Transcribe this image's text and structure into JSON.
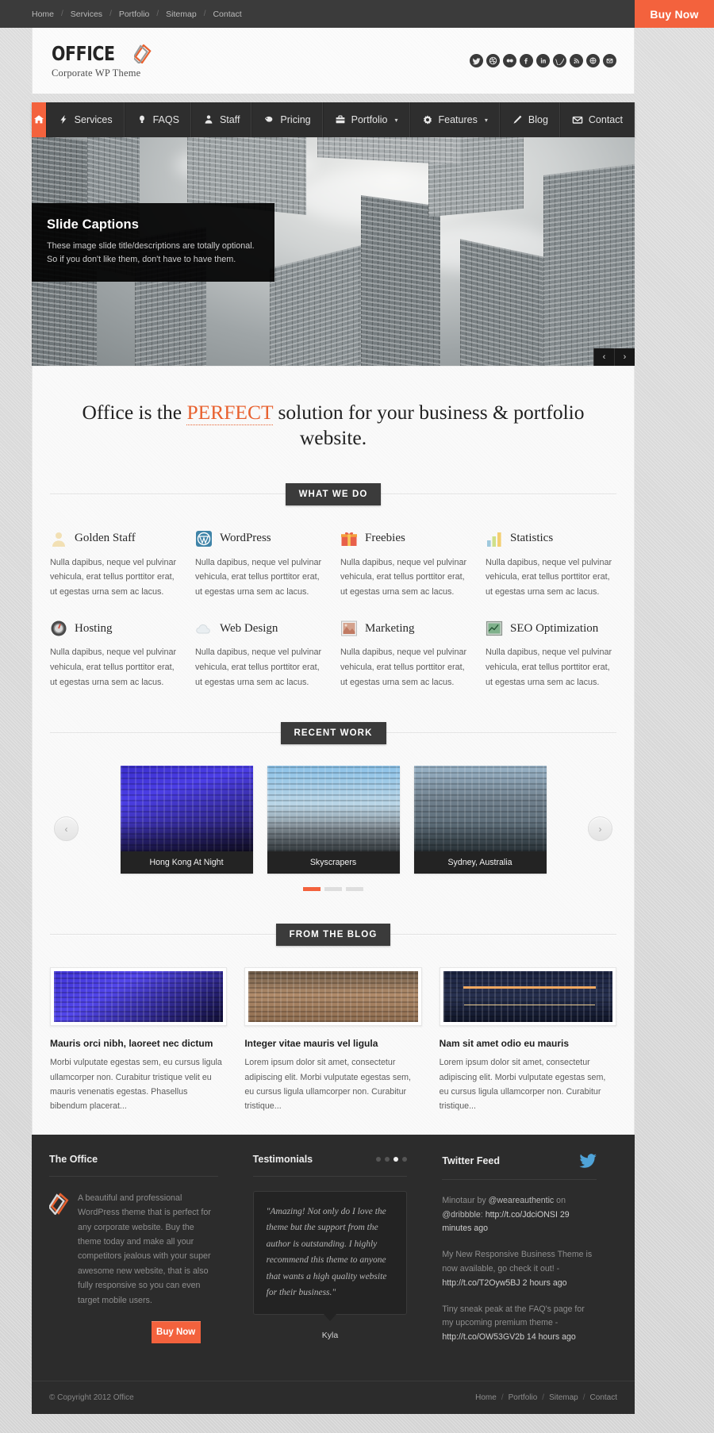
{
  "topbar": {
    "links": [
      "Home",
      "Services",
      "Portfolio",
      "Sitemap",
      "Contact"
    ],
    "buy_now": "Buy Now"
  },
  "header": {
    "logo_text": "OFFICE",
    "logo_sub": "Corporate WP Theme",
    "socials": [
      "twitter-icon",
      "dribbble-icon",
      "flickr-icon",
      "facebook-icon",
      "linkedin-icon",
      "vimeo-icon",
      "rss-icon",
      "google-plus-icon",
      "email-icon"
    ]
  },
  "nav": {
    "items": [
      {
        "label": "",
        "icon": "home-icon",
        "active": true
      },
      {
        "label": "Services",
        "icon": "bolt-icon"
      },
      {
        "label": "FAQS",
        "icon": "bulb-icon"
      },
      {
        "label": "Staff",
        "icon": "user-icon"
      },
      {
        "label": "Pricing",
        "icon": "tag-icon"
      },
      {
        "label": "Portfolio",
        "icon": "briefcase-icon",
        "caret": "▾"
      },
      {
        "label": "Features",
        "icon": "gear-icon",
        "caret": "▾"
      },
      {
        "label": "Blog",
        "icon": "pencil-icon"
      },
      {
        "label": "Contact",
        "icon": "envelope-icon"
      }
    ]
  },
  "slider": {
    "caption_title": "Slide Captions",
    "caption_text": "These image slide title/descriptions are totally optional. So if you don't like them, don't have to have them.",
    "prev": "‹",
    "next": "›"
  },
  "tagline": {
    "before": "Office is the ",
    "highlight": "PERFECT",
    "after": " solution for your business & portfolio website."
  },
  "what_we_do": {
    "heading": "WHAT WE DO",
    "body": "Nulla dapibus, neque vel pulvinar vehicula, erat tellus porttitor erat, ut egestas urna sem ac lacus.",
    "items": [
      {
        "title": "Golden Staff",
        "icon": "person-silhouette-icon"
      },
      {
        "title": "WordPress",
        "icon": "wordpress-icon"
      },
      {
        "title": "Freebies",
        "icon": "gift-icon"
      },
      {
        "title": "Statistics",
        "icon": "bar-chart-icon"
      },
      {
        "title": "Hosting",
        "icon": "server-dial-icon"
      },
      {
        "title": "Web Design",
        "icon": "cloud-icon"
      },
      {
        "title": "Marketing",
        "icon": "photo-icon"
      },
      {
        "title": "SEO Optimization",
        "icon": "chart-screen-icon"
      }
    ]
  },
  "recent_work": {
    "heading": "RECENT WORK",
    "prev": "‹",
    "next": "›",
    "items": [
      {
        "caption": "Hong Kong At Night"
      },
      {
        "caption": "Skyscrapers"
      },
      {
        "caption": "Sydney, Australia"
      }
    ],
    "dots": 3,
    "active_dot": 0
  },
  "from_the_blog": {
    "heading": "FROM THE BLOG",
    "posts": [
      {
        "title": "Mauris orci nibh, laoreet nec dictum",
        "excerpt": "Morbi vulputate egestas sem, eu cursus ligula ullamcorper non. Curabitur tristique velit eu mauris venenatis egestas. Phasellus bibendum placerat..."
      },
      {
        "title": "Integer vitae mauris vel ligula",
        "excerpt": "Lorem ipsum dolor sit amet, consectetur adipiscing elit. Morbi vulputate egestas sem, eu cursus ligula ullamcorper non. Curabitur tristique..."
      },
      {
        "title": "Nam sit amet odio eu mauris",
        "excerpt": "Lorem ipsum dolor sit amet, consectetur adipiscing elit. Morbi vulputate egestas sem, eu cursus ligula ullamcorper non. Curabitur tristique..."
      }
    ]
  },
  "footer": {
    "about": {
      "heading": "The Office",
      "text": "A beautiful and professional WordPress theme that is perfect for any corporate website. Buy the theme today and make all your competitors jealous with your super awesome new website, that is also fully responsive so you can even target mobile users.",
      "buy_now": "Buy Now"
    },
    "testimonials": {
      "heading": "Testimonials",
      "quote": "\"Amazing! Not only do I love the theme but the support from the author is outstanding. I highly recommend this theme to anyone that wants a high quality website for their business.\"",
      "author": "Kyla",
      "dots": 4,
      "active_dot": 2
    },
    "twitter": {
      "heading": "Twitter Feed",
      "icon": "twitter-bird-icon",
      "tweets": [
        {
          "pre": "Minotaur by ",
          "mention": "@weareauthentic",
          "mid": " on ",
          "mention2": "@dribbble",
          "post": ":",
          "link": "http://t.co/JdciONSI",
          "ago": "29 minutes ago"
        },
        {
          "pre": "My New Responsive Business Theme is now available, go check it out! - ",
          "link": "http://t.co/T2Oyw5BJ",
          "ago": "2 hours ago"
        },
        {
          "pre": "Tiny sneak peak at the FAQ's page for my upcoming premium theme - ",
          "link": "http://t.co/OW53GV2b",
          "ago": "14 hours ago"
        }
      ]
    }
  },
  "copyright": {
    "text": "© Copyright 2012 Office",
    "links": [
      "Home",
      "Portfolio",
      "Sitemap",
      "Contact"
    ]
  },
  "colors": {
    "accent": "#f3623d",
    "dark": "#2c2c2c",
    "nav_dark": "#2e2e2e",
    "page_bg": "#d9d9d9"
  }
}
